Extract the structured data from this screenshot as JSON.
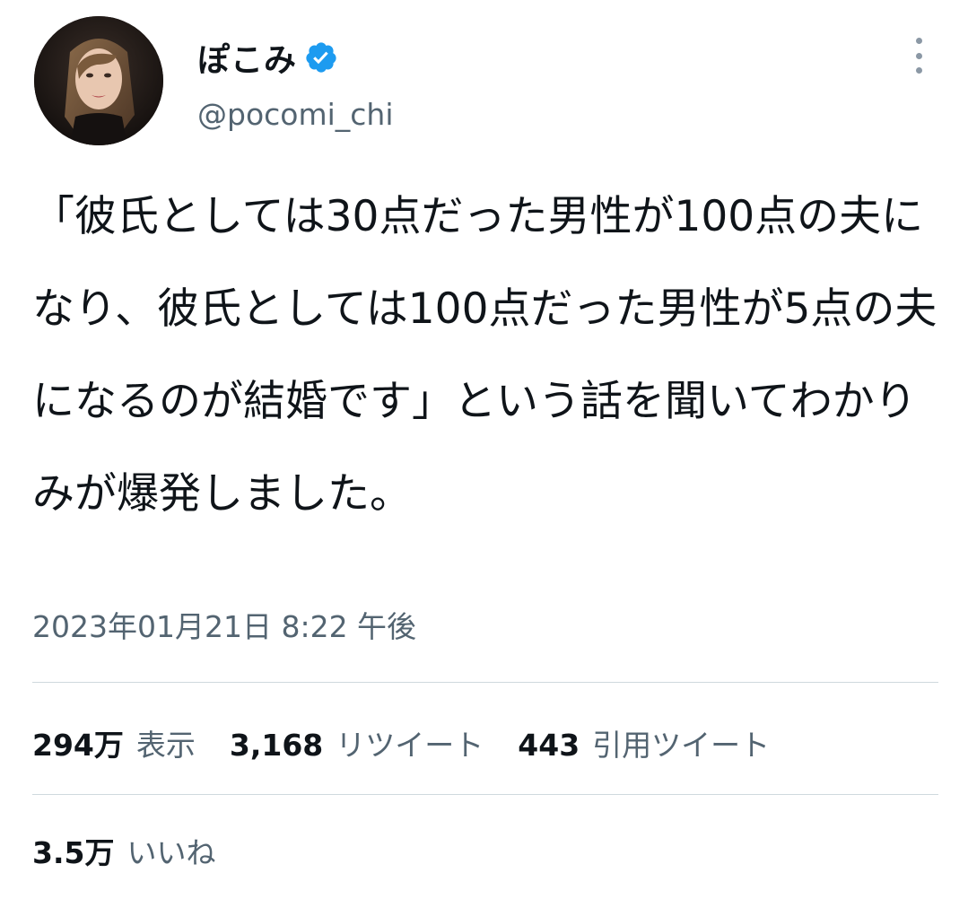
{
  "author": {
    "display_name": "ぽこみ",
    "handle": "@pocomi_chi",
    "verified": true,
    "verified_color": "#1d9bf0"
  },
  "tweet": {
    "text": "「彼氏としては30点だった男性が100点の夫になり、彼氏としては100点だった男性が5点の夫になるのが結婚です」という話を聞いてわかりみが爆発しました。",
    "timestamp": "2023年01月21日 8:22 午後"
  },
  "stats": {
    "views": {
      "count": "294万",
      "label": "表示"
    },
    "retweets": {
      "count": "3,168",
      "label": "リツイート"
    },
    "quotes": {
      "count": "443",
      "label": "引用ツイート"
    },
    "likes": {
      "count": "3.5万",
      "label": "いいね"
    }
  },
  "icons": {
    "verified": "verified-badge-icon",
    "more": "more-vertical-icon",
    "avatar": "profile-photo"
  },
  "colors": {
    "text_primary": "#0f1419",
    "text_secondary": "#536471",
    "divider": "#cfd9de"
  }
}
